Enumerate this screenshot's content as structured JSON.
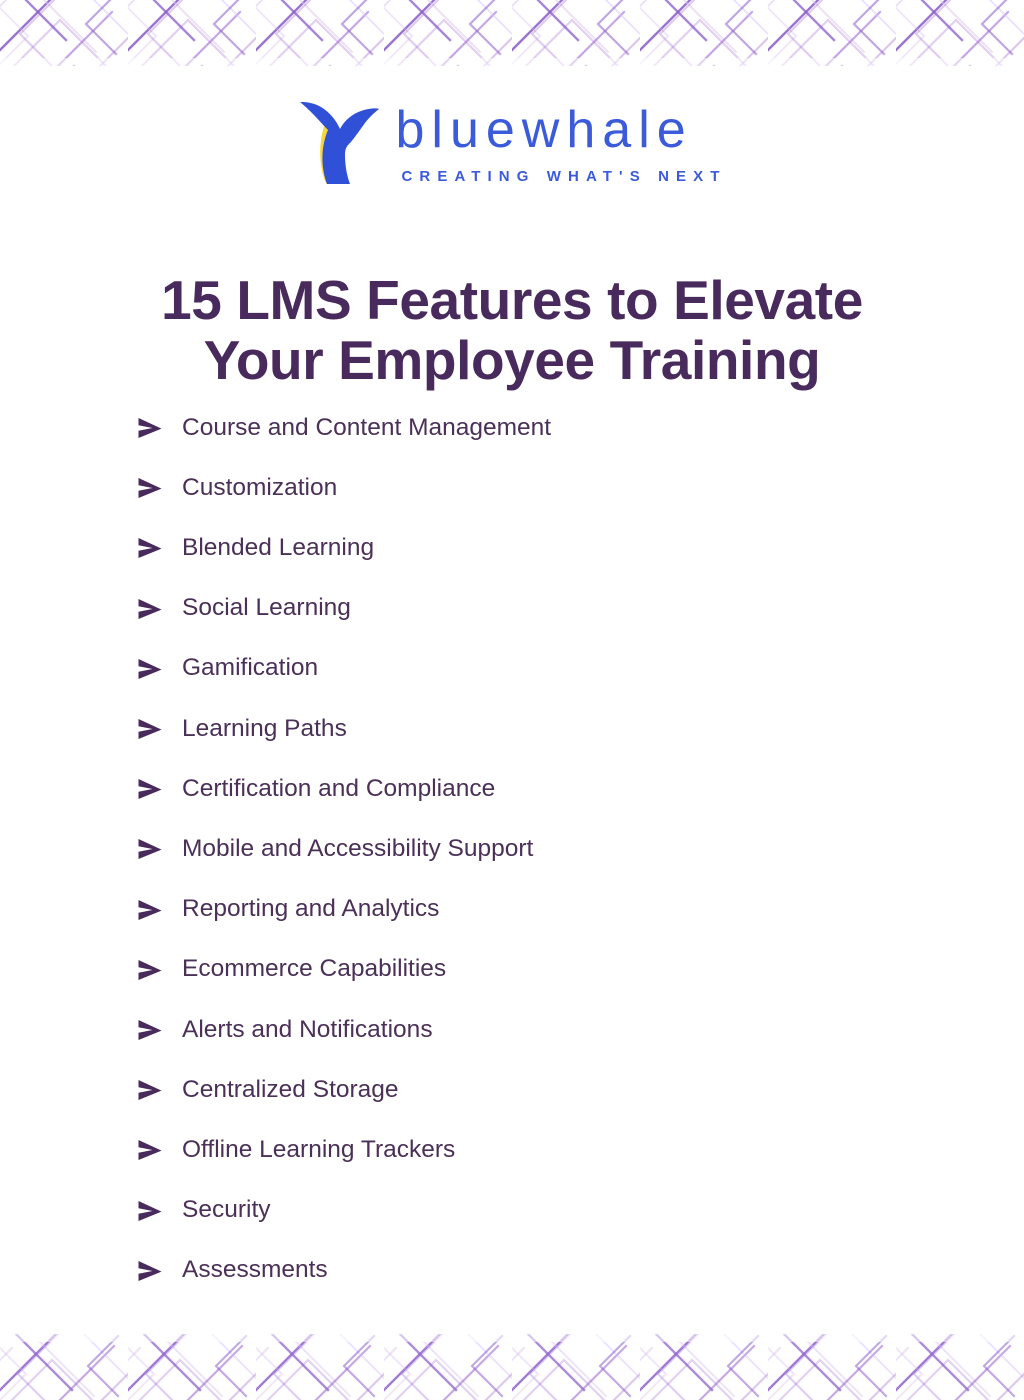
{
  "brand": {
    "logo_mark_name": "whale-tail-logo",
    "wordmark": "bluewhale",
    "tagline": "CREATING WHAT'S NEXT",
    "colors": {
      "blue": "#3b5bda",
      "yellow": "#f5d63d",
      "title_purple": "#482a5c",
      "body_purple": "#4b3057",
      "pattern_purple": "#8b5cc9"
    }
  },
  "header": {
    "title_line_1": "15 LMS Features to Elevate",
    "title_line_2": "Your Employee Training"
  },
  "features": [
    {
      "label": "Course and Content Management"
    },
    {
      "label": "Customization"
    },
    {
      "label": "Blended Learning"
    },
    {
      "label": "Social Learning"
    },
    {
      "label": "Gamification"
    },
    {
      "label": "Learning Paths"
    },
    {
      "label": "Certification and Compliance"
    },
    {
      "label": "Mobile and Accessibility Support"
    },
    {
      "label": "Reporting and Analytics"
    },
    {
      "label": "Ecommerce Capabilities"
    },
    {
      "label": "Alerts and Notifications"
    },
    {
      "label": "Centralized Storage"
    },
    {
      "label": "Offline Learning Trackers"
    },
    {
      "label": "Security"
    },
    {
      "label": "Assessments"
    }
  ],
  "decoration": {
    "top_band_name": "geometric-chevron-pattern-top",
    "bottom_band_name": "geometric-chevron-pattern-bottom"
  }
}
